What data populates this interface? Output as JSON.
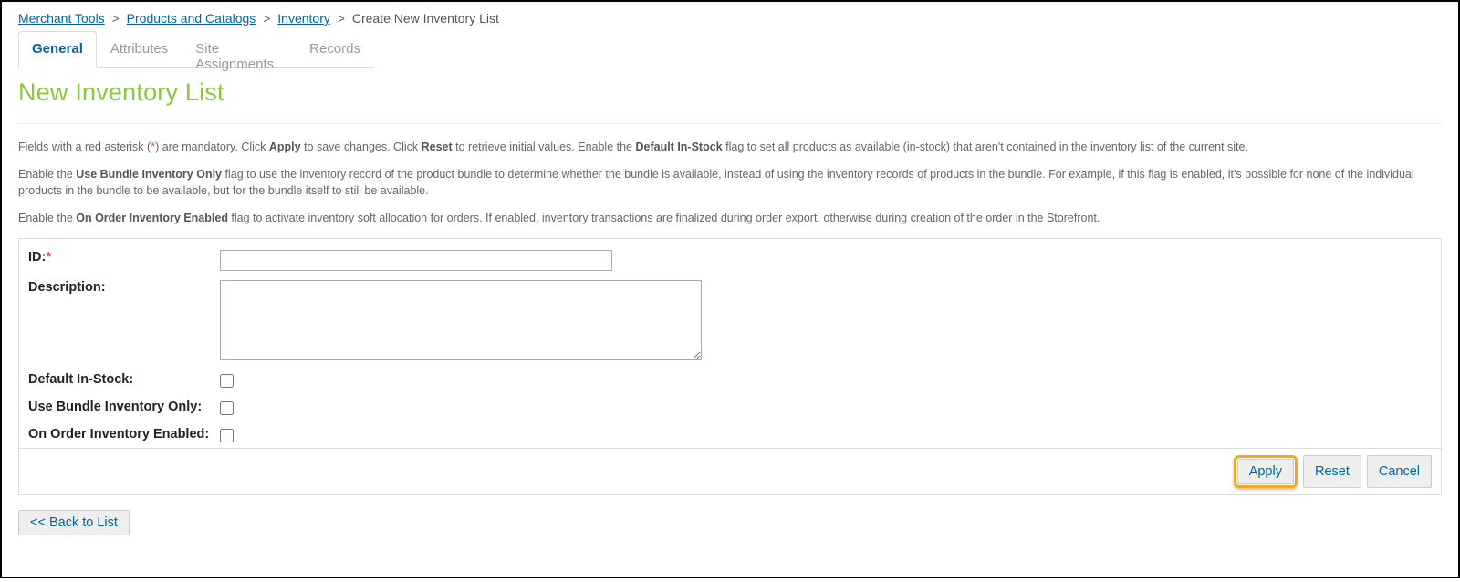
{
  "breadcrumb": {
    "links": [
      "Merchant Tools",
      "Products and Catalogs",
      "Inventory"
    ],
    "current": "Create New Inventory List"
  },
  "tabs": [
    "General",
    "Attributes",
    "Site Assignments",
    "Records"
  ],
  "activeTab": 0,
  "page_title": "New Inventory List",
  "help": {
    "p1_a": "Fields with a red asterisk (",
    "p1_star": "*",
    "p1_b": ") are mandatory. Click ",
    "p1_apply": "Apply",
    "p1_c": " to save changes. Click ",
    "p1_reset": "Reset",
    "p1_d": " to retrieve initial values. Enable the ",
    "p1_default": "Default In-Stock",
    "p1_e": " flag to set all products as available (in-stock) that aren't contained in the inventory list of the current site.",
    "p2_a": "Enable the ",
    "p2_bundle": "Use Bundle Inventory Only",
    "p2_b": " flag to use the inventory record of the product bundle to determine whether the bundle is available, instead of using the inventory records of products in the bundle. For example, if this flag is enabled, it's possible for none of the individual products in the bundle to be available, but for the bundle itself to still be available.",
    "p3_a": "Enable the ",
    "p3_onorder": "On Order Inventory Enabled",
    "p3_b": " flag to activate inventory soft allocation for orders. If enabled, inventory transactions are finalized during order export, otherwise during creation of the order in the Storefront."
  },
  "form": {
    "labels": {
      "id": "ID:",
      "description": "Description:",
      "default_in_stock": "Default In-Stock:",
      "use_bundle": "Use Bundle Inventory Only:",
      "on_order": "On Order Inventory Enabled:"
    },
    "values": {
      "id": "",
      "description": "",
      "default_in_stock": false,
      "use_bundle": false,
      "on_order": false
    }
  },
  "buttons": {
    "apply": "Apply",
    "reset": "Reset",
    "cancel": "Cancel",
    "back": "<< Back to List"
  }
}
